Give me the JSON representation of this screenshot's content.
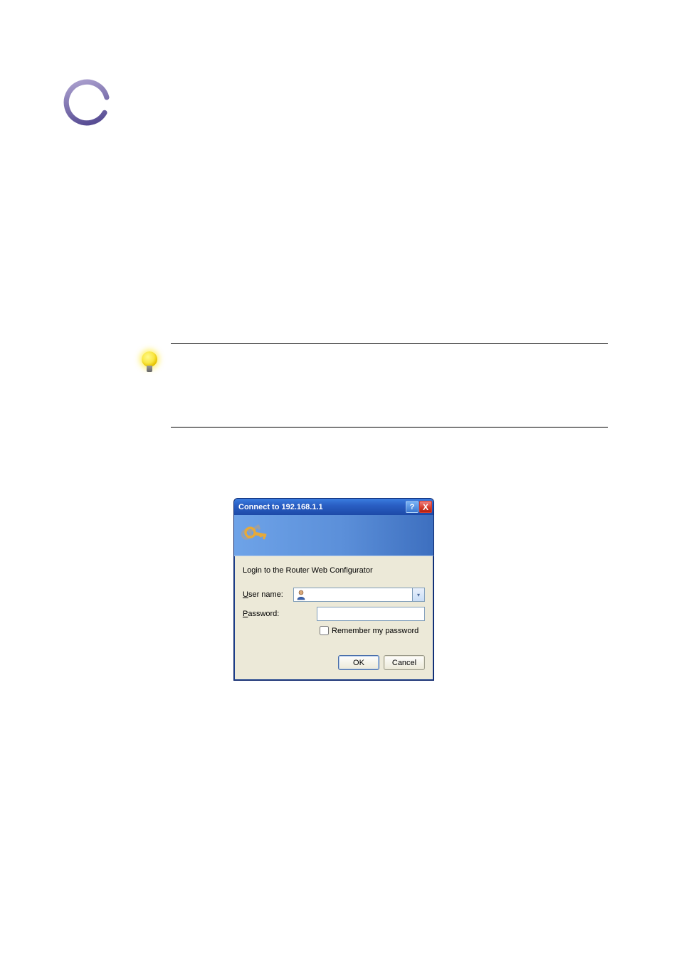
{
  "dialog": {
    "title": "Connect to 192.168.1.1",
    "prompt": "Login to the Router Web Configurator",
    "username_label_prefix": "U",
    "username_label_rest": "ser name:",
    "password_label_prefix": "P",
    "password_label_rest": "assword:",
    "remember_prefix": "R",
    "remember_rest": "emember my password",
    "username_value": "",
    "password_value": "",
    "ok_label": "OK",
    "cancel_label": "Cancel",
    "help_symbol": "?",
    "close_symbol": "X",
    "dropdown_symbol": "▾"
  }
}
